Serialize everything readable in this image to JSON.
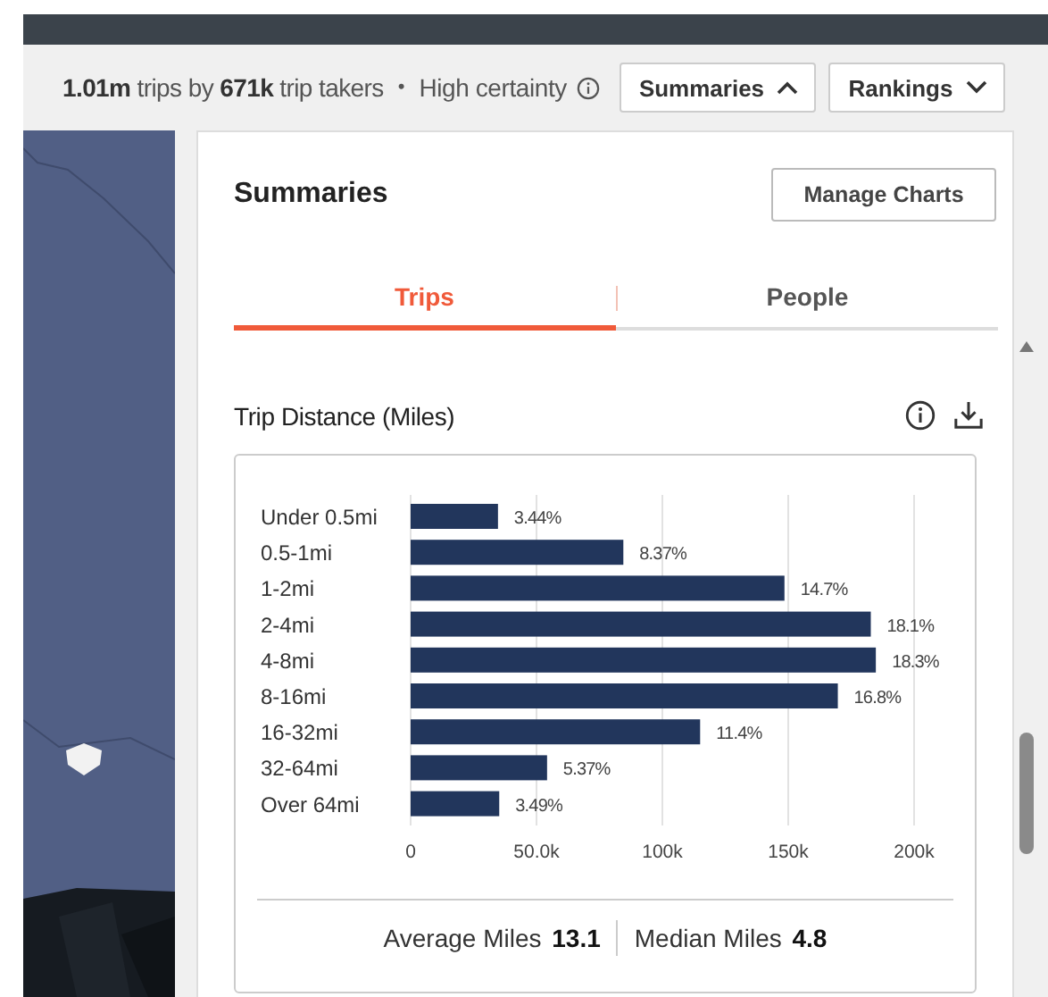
{
  "header": {
    "summary": "**1.01m** trips by **671k** trip takers",
    "separator": "•",
    "certainty": "High certainty",
    "buttons": [
      {
        "label": "Summaries",
        "expanded": true
      },
      {
        "label": "Rankings",
        "expanded": false
      }
    ]
  },
  "panel": {
    "title": "Summaries",
    "manage_button": "Manage Charts",
    "tabs": [
      {
        "label": "Trips",
        "selected": true
      },
      {
        "label": "People",
        "selected": false
      }
    ],
    "chart_title": "Trip Distance (Miles)",
    "chart_data": {
      "type": "bar",
      "orientation": "horizontal",
      "categories": [
        "Under 0.5mi",
        "0.5-1mi",
        "1-2mi",
        "2-4mi",
        "4-8mi",
        "8-16mi",
        "16-32mi",
        "32-64mi",
        "Over 64mi"
      ],
      "values": [
        34700,
        84500,
        148500,
        182800,
        184800,
        169700,
        115000,
        54200,
        35200
      ],
      "annotations": [
        "3.44%",
        "8.37%",
        "14.7%",
        "18.1%",
        "18.3%",
        "16.8%",
        "11.4%",
        "5.37%",
        "3.49%"
      ],
      "xlim": [
        0,
        200000
      ],
      "xticks": [
        {
          "value": 0,
          "label": "0"
        },
        {
          "value": 50000,
          "label": "50.0k"
        },
        {
          "value": 100000,
          "label": "100k"
        },
        {
          "value": 150000,
          "label": "150k"
        },
        {
          "value": 200000,
          "label": "200k"
        }
      ],
      "color": "#22365c",
      "grid": true
    },
    "stats": [
      {
        "label": "Average Miles",
        "value": "13.1"
      },
      {
        "label": "Median Miles",
        "value": "4.8"
      }
    ]
  }
}
